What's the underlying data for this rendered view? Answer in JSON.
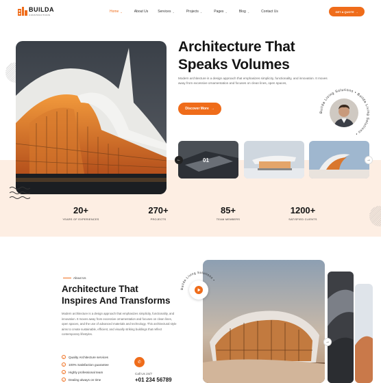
{
  "brand": {
    "name": "BUILDA",
    "tagline": "CONSTRUCTIONS",
    "accent": "#ef6c1a"
  },
  "nav": {
    "items": [
      {
        "label": "Home",
        "caret": true,
        "active": true
      },
      {
        "label": "About Us",
        "caret": false
      },
      {
        "label": "Services",
        "caret": true
      },
      {
        "label": "Projects",
        "caret": true
      },
      {
        "label": "Pages",
        "caret": true
      },
      {
        "label": "Blog",
        "caret": true
      },
      {
        "label": "Contact Us",
        "caret": false
      }
    ],
    "cta_label": "GET A QUOTE",
    "cta_icon": "arrow-right-icon"
  },
  "hero": {
    "title_line1": "Architecture That",
    "title_line2": "Speaks Volumes",
    "description": "Modern architecture is a design approach that emphasizes simplicity, functionality, and innovation. It moves away from excessive ornamentation and focuses on clean lines, open spaces,",
    "button_label": "Discover More",
    "circular_text": "Builda Living Solutions • Builda Living Solutions •",
    "slide_number": "01"
  },
  "stats": [
    {
      "value": "20+",
      "label": "YEARS OF EXPERIENCES"
    },
    {
      "value": "270+",
      "label": "PROJECTS"
    },
    {
      "value": "85+",
      "label": "TEAM MEMBERS"
    },
    {
      "value": "1200+",
      "label": "SATISFIED CLIENTS"
    }
  ],
  "about": {
    "tag": "About Us",
    "title_line1": "Architecture That",
    "title_line2": "Inspires And Transforms",
    "description": "Modern architecture is a design approach that emphasizes simplicity, functionality, and innovation. It moves away from excessive ornamentation and focuses on clean lines, open spaces, and the use of advanced materials and technology. This architectural style aims to create sustainable, efficient, and visually striking buildings that reflect contemporary lifestyles.",
    "features": [
      "Quality Architecture services",
      "100% Satisfaction guarantee",
      "Highly professional team",
      "Dealing always on time"
    ],
    "call_label": "Call Us 24/7",
    "call_number": "+01 234 56789",
    "circular_text": "Builda Living Solutions •"
  }
}
